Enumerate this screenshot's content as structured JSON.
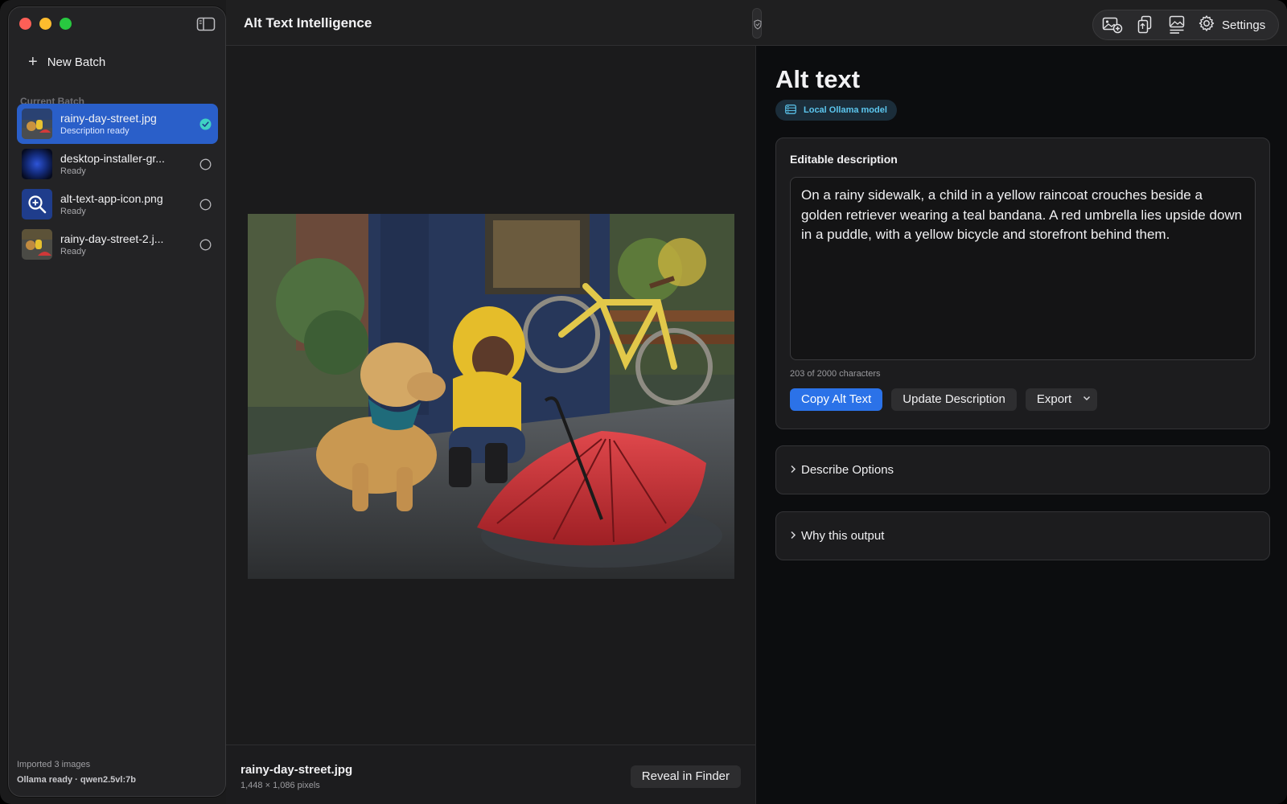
{
  "app": {
    "title": "Alt Text Intelligence"
  },
  "sidebar": {
    "new_batch_label": "New Batch",
    "section_label": "Current Batch",
    "items": [
      {
        "name": "rainy-day-street.jpg",
        "status": "Description ready",
        "selected": true,
        "state": "done"
      },
      {
        "name": "desktop-installer-gr...",
        "status": "Ready",
        "selected": false,
        "state": "pending"
      },
      {
        "name": "alt-text-app-icon.png",
        "status": "Ready",
        "selected": false,
        "state": "pending"
      },
      {
        "name": "rainy-day-street-2.j...",
        "status": "Ready",
        "selected": false,
        "state": "pending"
      }
    ],
    "footer": {
      "imported": "Imported 3 images",
      "model_status": "Ollama ready · qwen2.5vl:7b"
    }
  },
  "toolbar": {
    "settings_label": "Settings",
    "icons": [
      "add-image-icon",
      "copy-document-icon",
      "image-caption-icon",
      "gear-icon"
    ]
  },
  "preview": {
    "filename": "rainy-day-street.jpg",
    "dimensions": "1,448 × 1,086 pixels",
    "reveal_label": "Reveal in Finder"
  },
  "inspector": {
    "title": "Alt text",
    "model_badge": "Local Ollama model",
    "editable_label": "Editable description",
    "description": "On a rainy sidewalk, a child in a yellow raincoat crouches beside a golden retriever wearing a teal bandana. A red umbrella lies upside down in a puddle, with a yellow bicycle and storefront behind them.",
    "char_count": "203 of 2000 characters",
    "buttons": {
      "copy": "Copy Alt Text",
      "update": "Update Description",
      "export": "Export"
    },
    "sections": {
      "options": "Describe Options",
      "why": "Why this output"
    }
  },
  "colors": {
    "accent": "#2b72e8",
    "selection": "#2a5fc9",
    "badge_text": "#5cc6ee",
    "check": "#3fd1c4"
  }
}
